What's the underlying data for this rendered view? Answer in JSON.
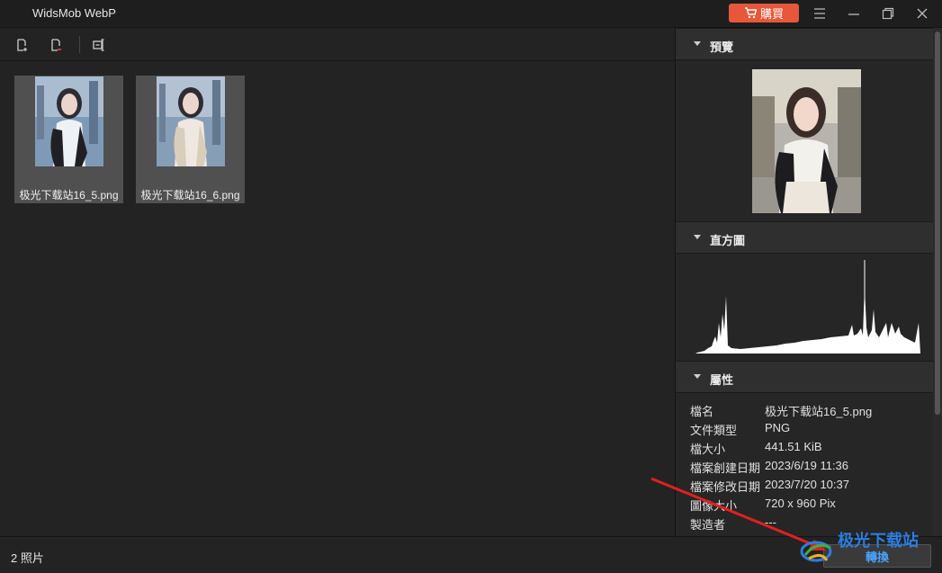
{
  "window": {
    "title": "WidsMob WebP",
    "buy_label": "購買"
  },
  "toolbar": {
    "add_label": "add-file",
    "remove_label": "remove-file",
    "rename_label": "rename"
  },
  "photos": [
    {
      "filename": "极光下载站16_5.png"
    },
    {
      "filename": "极光下载站16_6.png"
    }
  ],
  "panel": {
    "preview_title": "預覽",
    "histogram_title": "直方圖",
    "properties_title": "屬性",
    "properties": [
      {
        "key": "檔名",
        "value": "极光下载站16_5.png"
      },
      {
        "key": "文件類型",
        "value": "PNG"
      },
      {
        "key": "檔大小",
        "value": "441.51 KiB"
      },
      {
        "key": "檔案創建日期",
        "value": "2023/6/19 11:36"
      },
      {
        "key": "檔案修改日期",
        "value": "2023/7/20 10:37"
      },
      {
        "key": "圖像大小",
        "value": "720 x 960 Pix"
      },
      {
        "key": "製造者",
        "value": "---"
      }
    ]
  },
  "status": {
    "count": "2 照片",
    "convert_label": "轉換"
  },
  "watermark": {
    "text": "极光下载站"
  },
  "colors": {
    "accent": "#e8573a",
    "convert_text": "#4aa3ff"
  }
}
